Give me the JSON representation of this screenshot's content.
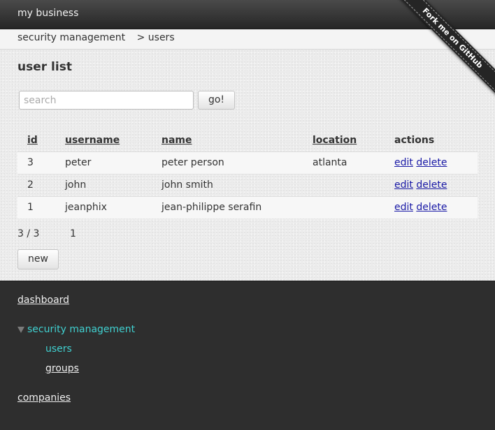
{
  "app": {
    "title": "my business"
  },
  "breadcrumb": {
    "parent": "security management",
    "separator": ">",
    "current": "users"
  },
  "page": {
    "title": "user list"
  },
  "search": {
    "placeholder": "search",
    "value": "",
    "button_label": "go!"
  },
  "table": {
    "columns": [
      {
        "key": "id",
        "label": "id",
        "sortable": true
      },
      {
        "key": "username",
        "label": "username",
        "sortable": true
      },
      {
        "key": "name",
        "label": "name",
        "sortable": true
      },
      {
        "key": "location",
        "label": "location",
        "sortable": true
      },
      {
        "key": "actions",
        "label": "actions",
        "sortable": false
      }
    ],
    "rows": [
      {
        "id": "3",
        "username": "peter",
        "name": "peter person",
        "location": "atlanta",
        "edit": "edit",
        "delete": "delete"
      },
      {
        "id": "2",
        "username": "john",
        "name": "john smith",
        "location": "",
        "edit": "edit",
        "delete": "delete"
      },
      {
        "id": "1",
        "username": "jeanphix",
        "name": "jean-philippe serafin",
        "location": "",
        "edit": "edit",
        "delete": "delete"
      }
    ]
  },
  "pagination": {
    "count": "3 / 3",
    "pages": [
      "1"
    ]
  },
  "new_button_label": "new",
  "nav": {
    "dashboard": "dashboard",
    "group": {
      "label": "security management",
      "expanded": true,
      "items": [
        {
          "label": "users",
          "active": true
        },
        {
          "label": "groups",
          "active": false
        }
      ]
    },
    "companies": "companies"
  },
  "ribbon": {
    "label": "Fork me on GitHub"
  },
  "colors": {
    "accent": "#40d0d0",
    "link": "#1a1aa6",
    "topbar": "#2e2e2e",
    "content_bg": "#ececec",
    "ribbon_bg": "#252525"
  },
  "icons": {
    "nav_group_toggle": "triangle-down-icon"
  }
}
